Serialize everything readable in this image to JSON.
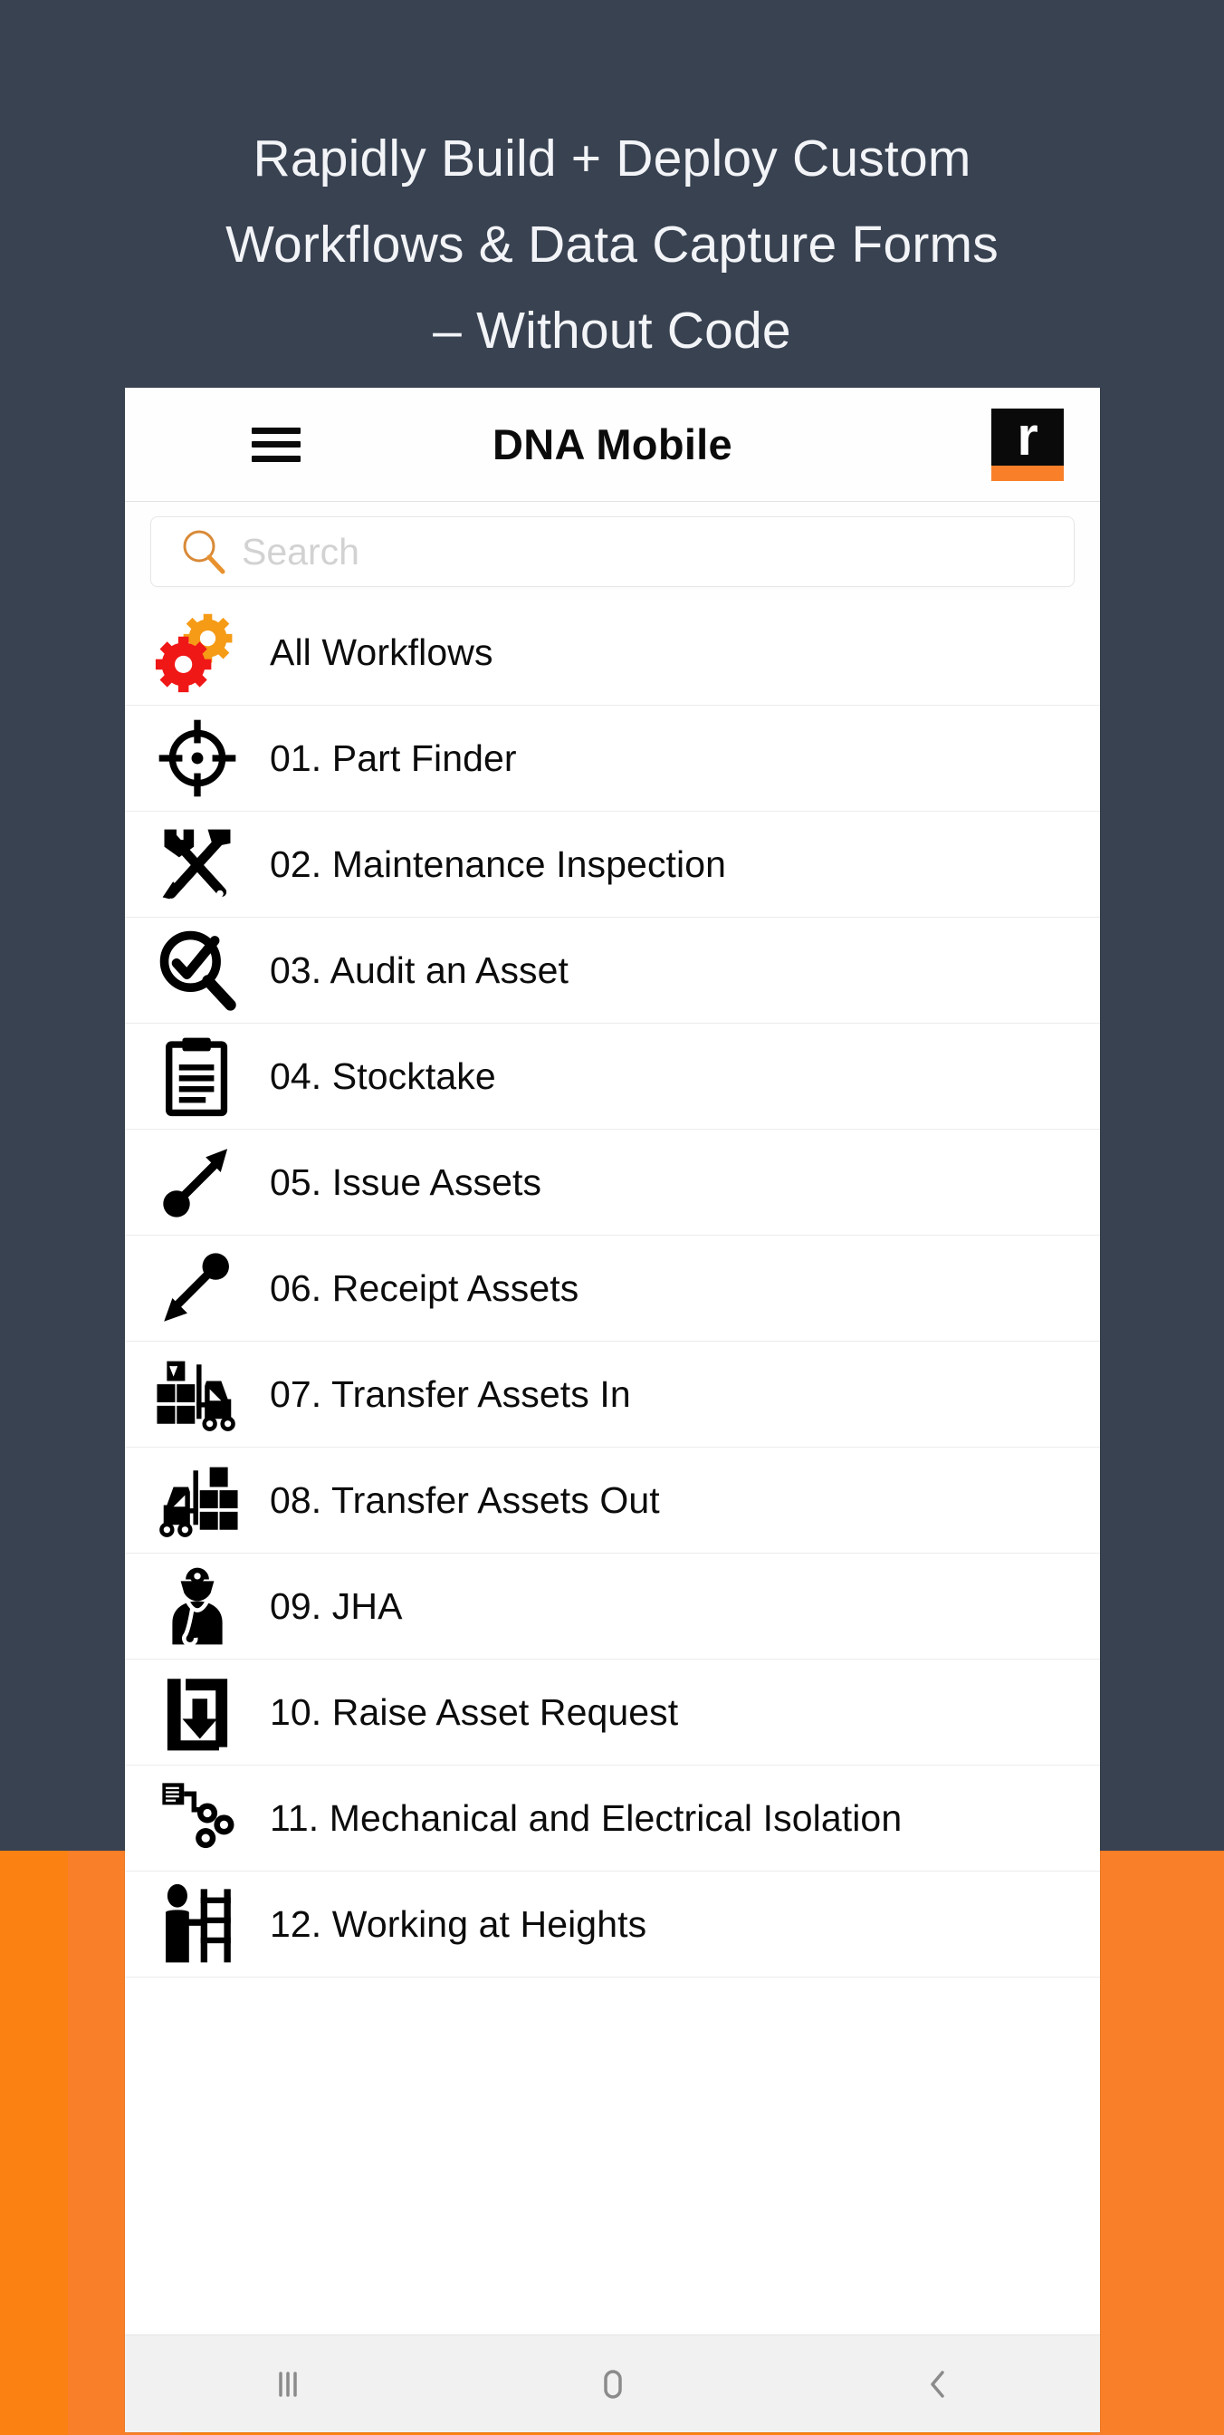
{
  "page": {
    "headline": "Rapidly Build + Deploy Custom\nWorkflows & Data Capture Forms\n– Without Code",
    "background_color": "#394251",
    "accent_orange": "#FB8112"
  },
  "appbar": {
    "menu_icon": "hamburger-icon",
    "title": "DNA Mobile",
    "logo_letter": "r"
  },
  "search": {
    "placeholder": "Search",
    "value": "",
    "icon": "search-icon",
    "icon_color": "#E08A2E"
  },
  "list": {
    "items": [
      {
        "label": "All Workflows",
        "icon": "gears-icon"
      },
      {
        "label": "01. Part Finder",
        "icon": "crosshair-target-icon"
      },
      {
        "label": "02. Maintenance Inspection",
        "icon": "wrench-screwdriver-icon"
      },
      {
        "label": "03. Audit an Asset",
        "icon": "magnifier-check-icon"
      },
      {
        "label": "04. Stocktake",
        "icon": "clipboard-icon"
      },
      {
        "label": "05. Issue Assets",
        "icon": "arrow-out-icon"
      },
      {
        "label": "06. Receipt Assets",
        "icon": "arrow-in-icon"
      },
      {
        "label": "07. Transfer Assets In",
        "icon": "forklift-in-icon"
      },
      {
        "label": "08. Transfer Assets Out",
        "icon": "forklift-out-icon"
      },
      {
        "label": "09. JHA",
        "icon": "worker-icon"
      },
      {
        "label": "10. Raise Asset Request",
        "icon": "download-box-icon"
      },
      {
        "label": "11. Mechanical and Electrical Isolation",
        "icon": "isolation-gears-icon"
      },
      {
        "label": "12. Working at Heights",
        "icon": "ladder-worker-icon"
      }
    ]
  },
  "navbar": {
    "recents_label": "recent-apps",
    "home_label": "home",
    "back_label": "back"
  }
}
